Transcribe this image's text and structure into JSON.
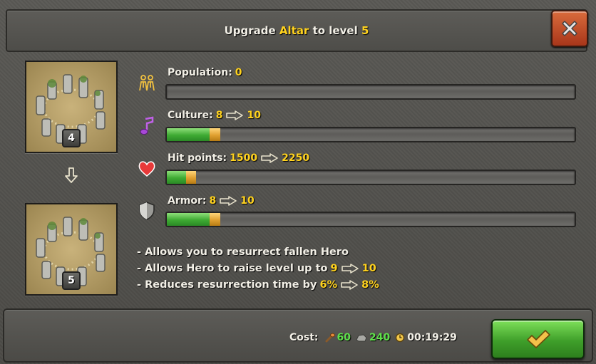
{
  "dialog": {
    "title_prefix": "Upgrade",
    "building": "Altar",
    "title_mid": "to level",
    "target_level": "5"
  },
  "thumbs": {
    "current_level": "4",
    "next_level": "5"
  },
  "stats": [
    {
      "label": "Population:",
      "value": "0",
      "to": "",
      "icon": "population-icon",
      "fill": 0,
      "gain": 0
    },
    {
      "label": "Culture:",
      "value": "8",
      "to": "10",
      "icon": "music-note-icon",
      "fill": 0.105,
      "gain": 0.026
    },
    {
      "label": "Hit points:",
      "value": "1500",
      "to": "2250",
      "icon": "heart-icon",
      "fill": 0.047,
      "gain": 0.024
    },
    {
      "label": "Armor:",
      "value": "8",
      "to": "10",
      "icon": "shield-icon",
      "fill": 0.105,
      "gain": 0.026
    }
  ],
  "effects": [
    {
      "text": "- Allows you to resurrect fallen Hero",
      "from": "",
      "to": ""
    },
    {
      "text": "- Allows Hero to raise level up to",
      "from": "9",
      "to": "10"
    },
    {
      "text": "- Reduces resurrection time by",
      "from": "6%",
      "to": "8%"
    }
  ],
  "cost": {
    "label": "Cost:",
    "wood": "60",
    "stone": "240",
    "time": "00:19:29"
  },
  "colors": {
    "highlight": "#ffd21e",
    "cost_green": "#5ee04a",
    "bar_fill": "#3eaa33",
    "bar_gain": "#e0a030",
    "close_button": "#c04a26",
    "confirm_button": "#3f9f2a"
  }
}
